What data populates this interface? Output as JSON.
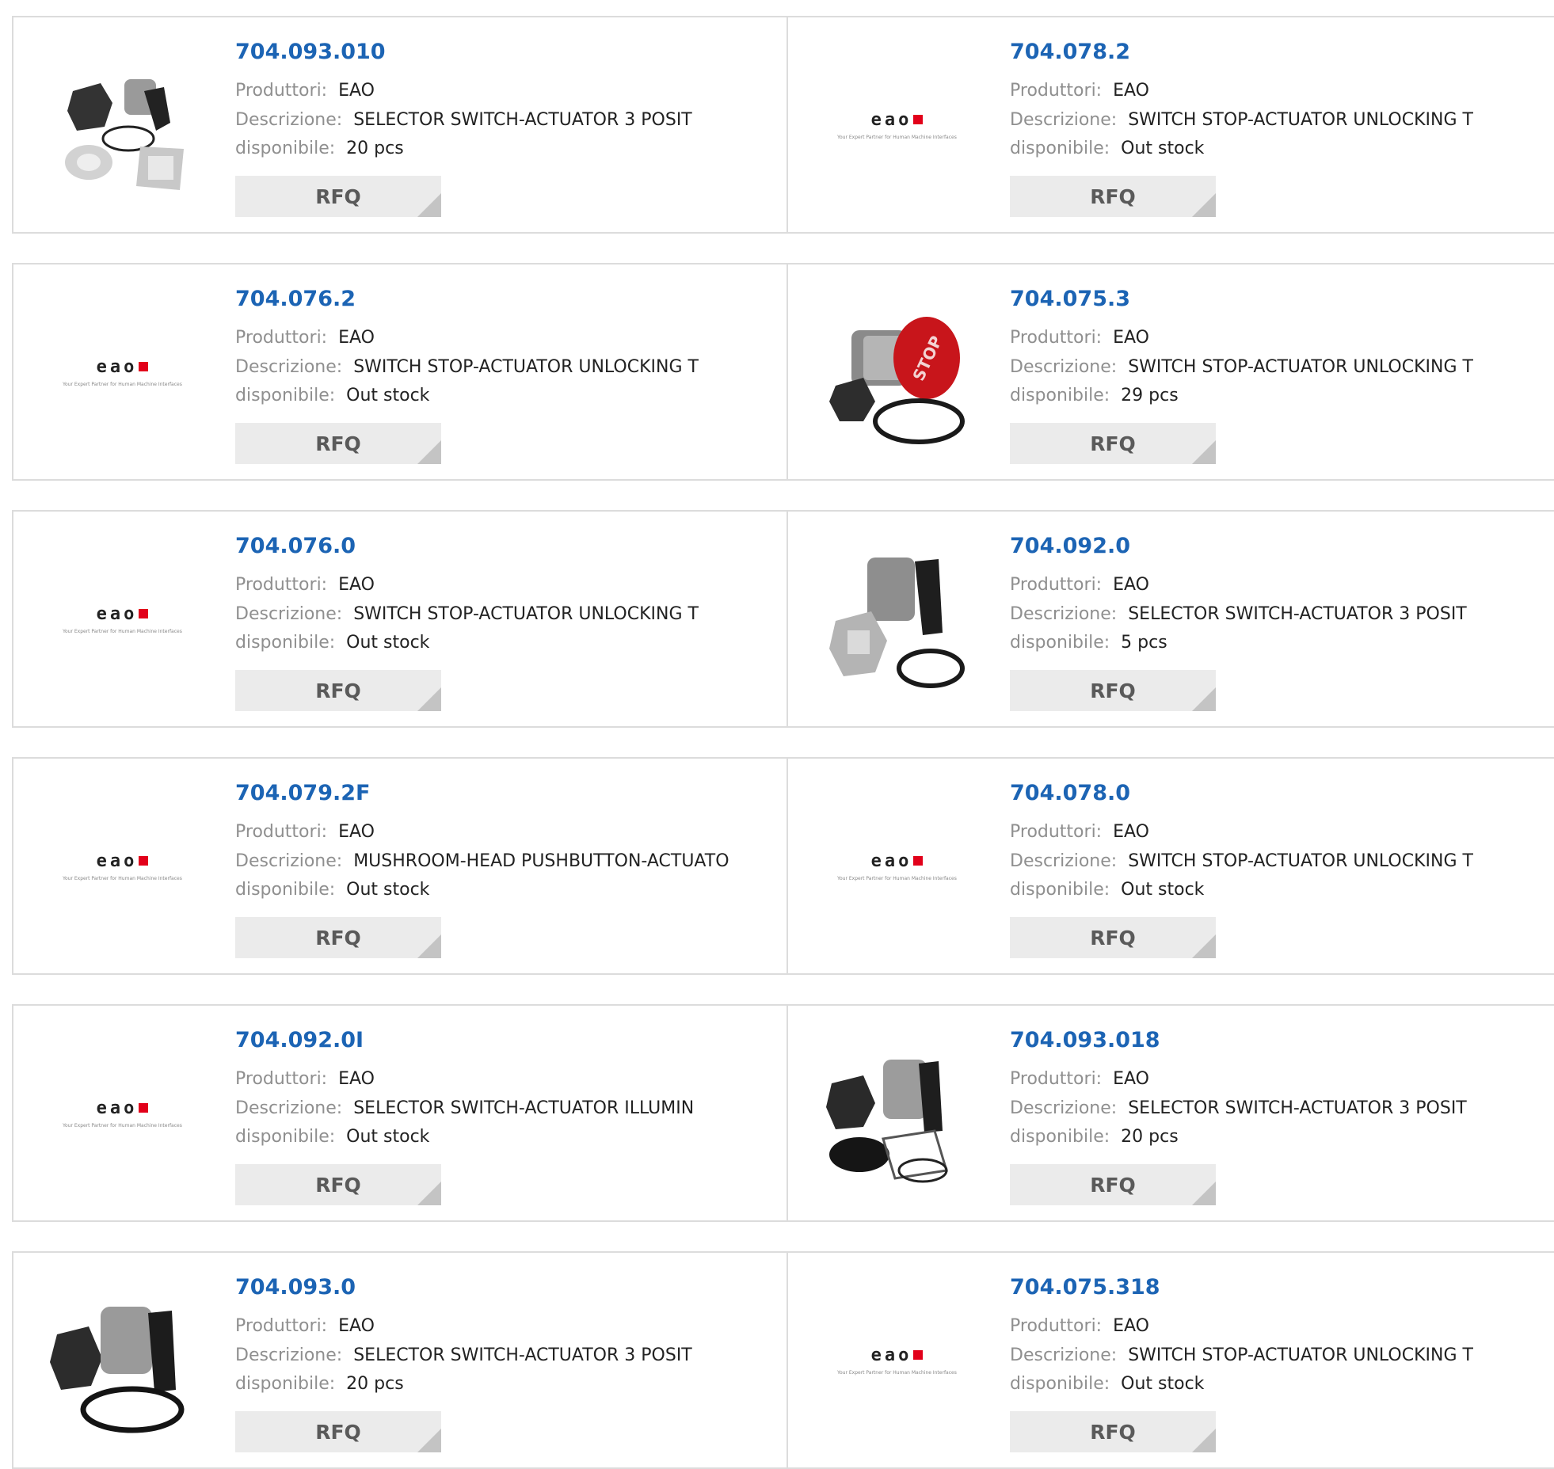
{
  "labels": {
    "manufacturer": "Produttori:",
    "description": "Descrizione:",
    "availability": "disponibile:",
    "rfq": "RFQ"
  },
  "logo": {
    "word": "eao",
    "tagline": "Your Expert Partner for Human Machine Interfaces",
    "accent_color": "#e2001a"
  },
  "colors": {
    "link": "#1c64b4",
    "key": "#8f8f8f"
  },
  "products": [
    {
      "part": "704.093.010",
      "manufacturer": "EAO",
      "description": "SELECTOR SWITCH-ACTUATOR 3 POSIT",
      "availability": "20 pcs",
      "image": "selector-kit-photo"
    },
    {
      "part": "704.078.2",
      "manufacturer": "EAO",
      "description": "SWITCH STOP-ACTUATOR UNLOCKING T",
      "availability": "Out stock",
      "image": "eao-logo"
    },
    {
      "part": "704.076.2",
      "manufacturer": "EAO",
      "description": "SWITCH STOP-ACTUATOR UNLOCKING T",
      "availability": "Out stock",
      "image": "eao-logo"
    },
    {
      "part": "704.075.3",
      "manufacturer": "EAO",
      "description": "SWITCH STOP-ACTUATOR UNLOCKING T",
      "availability": "29 pcs",
      "image": "stop-button-photo",
      "image_text": "STOP"
    },
    {
      "part": "704.076.0",
      "manufacturer": "EAO",
      "description": "SWITCH STOP-ACTUATOR UNLOCKING T",
      "availability": "Out stock",
      "image": "eao-logo"
    },
    {
      "part": "704.092.0",
      "manufacturer": "EAO",
      "description": "SELECTOR SWITCH-ACTUATOR 3 POSIT",
      "availability": "5 pcs",
      "image": "selector-grey-photo"
    },
    {
      "part": "704.079.2F",
      "manufacturer": "EAO",
      "description": "MUSHROOM-HEAD PUSHBUTTON-ACTUATO",
      "availability": "Out stock",
      "image": "eao-logo"
    },
    {
      "part": "704.078.0",
      "manufacturer": "EAO",
      "description": "SWITCH STOP-ACTUATOR UNLOCKING T",
      "availability": "Out stock",
      "image": "eao-logo"
    },
    {
      "part": "704.092.0I",
      "manufacturer": "EAO",
      "description": "SELECTOR SWITCH-ACTUATOR ILLUMIN",
      "availability": "Out stock",
      "image": "eao-logo"
    },
    {
      "part": "704.093.018",
      "manufacturer": "EAO",
      "description": "SELECTOR SWITCH-ACTUATOR 3 POSIT",
      "availability": "20 pcs",
      "image": "selector-black-kit-photo"
    },
    {
      "part": "704.093.0",
      "manufacturer": "EAO",
      "description": "SELECTOR SWITCH-ACTUATOR 3 POSIT",
      "availability": "20 pcs",
      "image": "selector-black-photo"
    },
    {
      "part": "704.075.318",
      "manufacturer": "EAO",
      "description": "SWITCH STOP-ACTUATOR UNLOCKING T",
      "availability": "Out stock",
      "image": "eao-logo"
    }
  ]
}
